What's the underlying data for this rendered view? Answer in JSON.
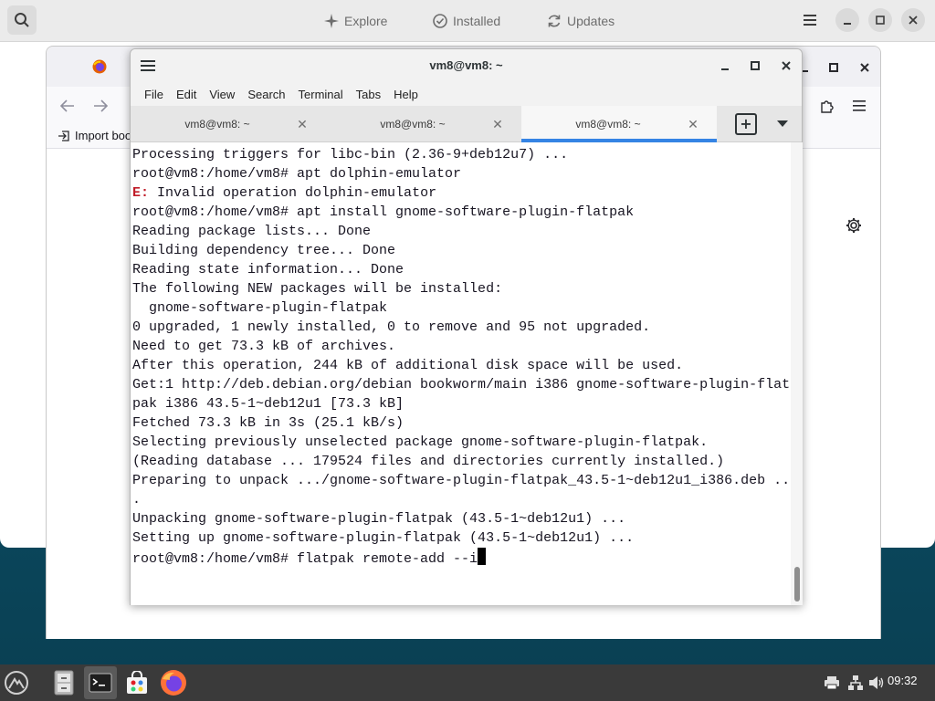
{
  "software": {
    "tabs": [
      {
        "label": "Explore"
      },
      {
        "label": "Installed"
      },
      {
        "label": "Updates"
      }
    ]
  },
  "firefox": {
    "bookmarks": {
      "import_label": "Import boo"
    }
  },
  "terminal": {
    "title": "vm8@vm8: ~",
    "menu": [
      "File",
      "Edit",
      "View",
      "Search",
      "Terminal",
      "Tabs",
      "Help"
    ],
    "tabs": [
      {
        "label": "vm8@vm8: ~"
      },
      {
        "label": "vm8@vm8: ~"
      },
      {
        "label": "vm8@vm8: ~"
      }
    ],
    "lines": [
      "Processing triggers for libc-bin (2.36-9+deb12u7) ...",
      "root@vm8:/home/vm8# apt dolphin-emulator",
      {
        "prefix": "E:",
        "text": " Invalid operation dolphin-emulator"
      },
      "root@vm8:/home/vm8# apt install gnome-software-plugin-flatpak",
      "Reading package lists... Done",
      "Building dependency tree... Done",
      "Reading state information... Done",
      "The following NEW packages will be installed:",
      "  gnome-software-plugin-flatpak",
      "0 upgraded, 1 newly installed, 0 to remove and 95 not upgraded.",
      "Need to get 73.3 kB of archives.",
      "After this operation, 244 kB of additional disk space will be used.",
      "Get:1 http://deb.debian.org/debian bookworm/main i386 gnome-software-plugin-flat",
      "pak i386 43.5-1~deb12u1 [73.3 kB]",
      "Fetched 73.3 kB in 3s (25.1 kB/s)",
      "Selecting previously unselected package gnome-software-plugin-flatpak.",
      "(Reading database ... 179524 files and directories currently installed.)",
      "Preparing to unpack .../gnome-software-plugin-flatpak_43.5-1~deb12u1_i386.deb ..",
      ".",
      "Unpacking gnome-software-plugin-flatpak (43.5-1~deb12u1) ...",
      "Setting up gnome-software-plugin-flatpak (43.5-1~deb12u1) ...",
      {
        "prompt": "root@vm8:/home/vm8# flatpak remote-add --i",
        "cursor": true
      }
    ]
  },
  "taskbar": {
    "clock": "09:32"
  }
}
